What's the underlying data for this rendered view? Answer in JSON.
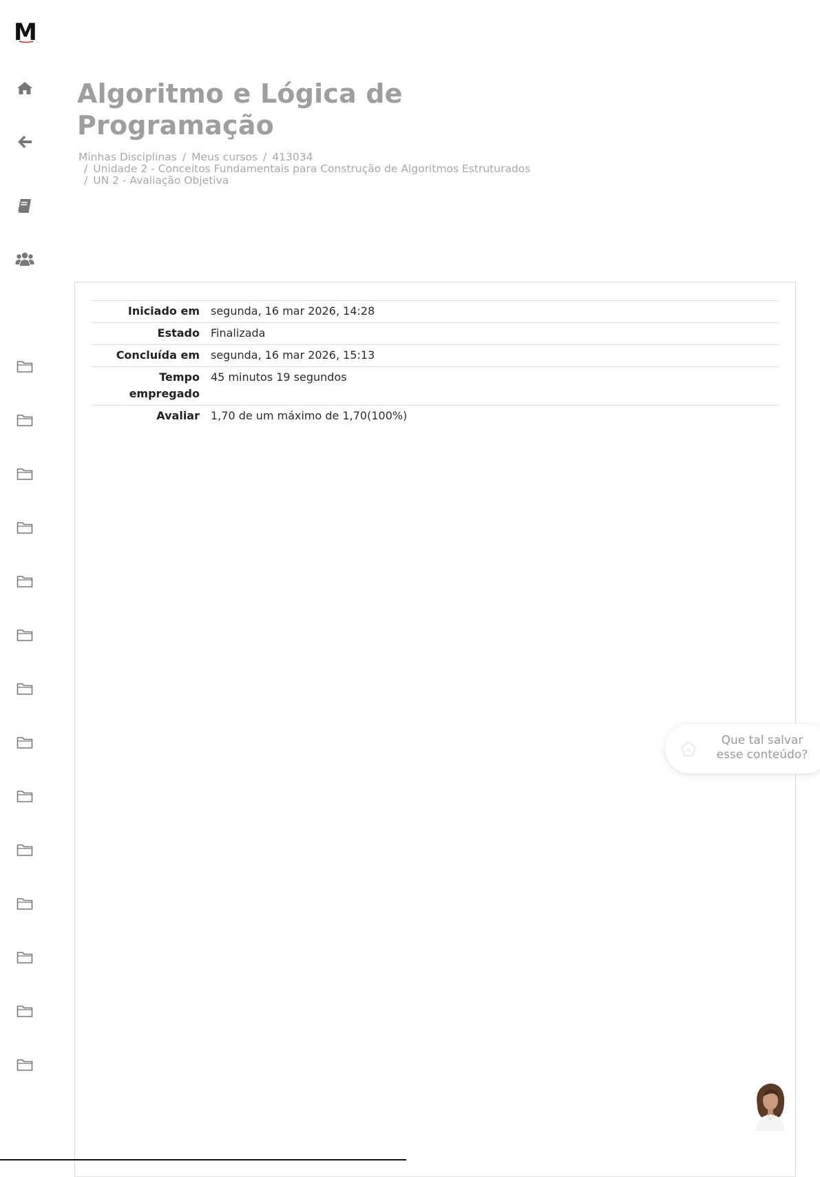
{
  "logo": {
    "letter": "M"
  },
  "sidebar": {
    "nav": [
      {
        "icon": "home-icon"
      },
      {
        "icon": "back-arrow-icon"
      },
      {
        "icon": "book-icon"
      },
      {
        "icon": "users-icon"
      }
    ],
    "folders_count_label": "",
    "folder_icon": "folder-icon"
  },
  "header": {
    "course_title": "Algoritmo e Lógica de Programação",
    "breadcrumb": {
      "item1": "Minhas Disciplinas",
      "item2": "Meus cursos",
      "item3": "413034",
      "item4": "Unidade 2 - Conceitos Fundamentais para Construção de Algoritmos Estruturados",
      "item5": "UN 2 - Avaliação Objetiva",
      "separator": "/"
    }
  },
  "summary": {
    "rows": [
      {
        "label": "Iniciado em",
        "value": "segunda, 16 mar 2026, 14:28"
      },
      {
        "label": "Estado",
        "value": "Finalizada"
      },
      {
        "label": "Concluída em",
        "value": "segunda, 16 mar 2026, 15:13"
      },
      {
        "label": "Tempo empregado",
        "value": "45 minutos 19 segundos"
      },
      {
        "label": "Avaliar",
        "value": "1,70 de um máximo de 1,70(100%)"
      }
    ]
  },
  "save_prompt": {
    "text": "Que tal salvar esse conteúdo?"
  },
  "colors": {
    "title_gray": "#9e9e9e",
    "icon_gray": "#777777",
    "logo_black": "#111111",
    "logo_accent": "#d62828"
  }
}
